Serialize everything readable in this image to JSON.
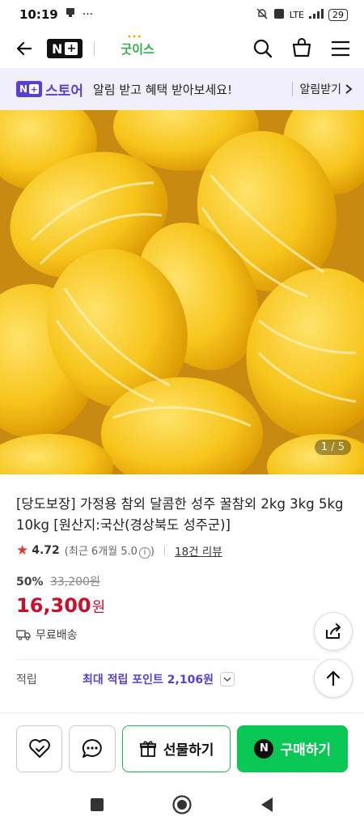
{
  "status_bar": {
    "time": "10:19",
    "extra": "···",
    "battery": "29",
    "network": "LTE"
  },
  "nav": {
    "brand_logo": "N",
    "brand_plus": "+",
    "shop_name": "굿이스"
  },
  "promo": {
    "logo_n": "N",
    "logo_plus": "+",
    "store": "스토어",
    "message": "알림 받고 혜택 받아보세요!",
    "cta": "알림받기"
  },
  "image": {
    "current": "1",
    "total": "/ 5"
  },
  "product": {
    "title": "[당도보장] 가정용 참외 달콤한 성주 꿀참외 2kg 3kg 5kg 10kg [원산지:국산(경상북도 성주군)]",
    "rating": "4.72",
    "recent_rating": "(최근 6개월 5.0",
    "info_glyph": "i",
    "recent_close": ")",
    "reviews": "18건 리뷰",
    "discount": "50%",
    "original_price": "33,200원",
    "price": "16,300",
    "currency": "원",
    "shipping": "무료배송"
  },
  "points": {
    "label": "적립",
    "value": "최대 적립 포인트 2,106원"
  },
  "actions": {
    "gift": "선물하기",
    "buy_badge": "N",
    "buy": "구매하기"
  },
  "colors": {
    "accent_purple": "#5b3fd3",
    "buy_green": "#08c755",
    "price_red": "#c8102e"
  }
}
